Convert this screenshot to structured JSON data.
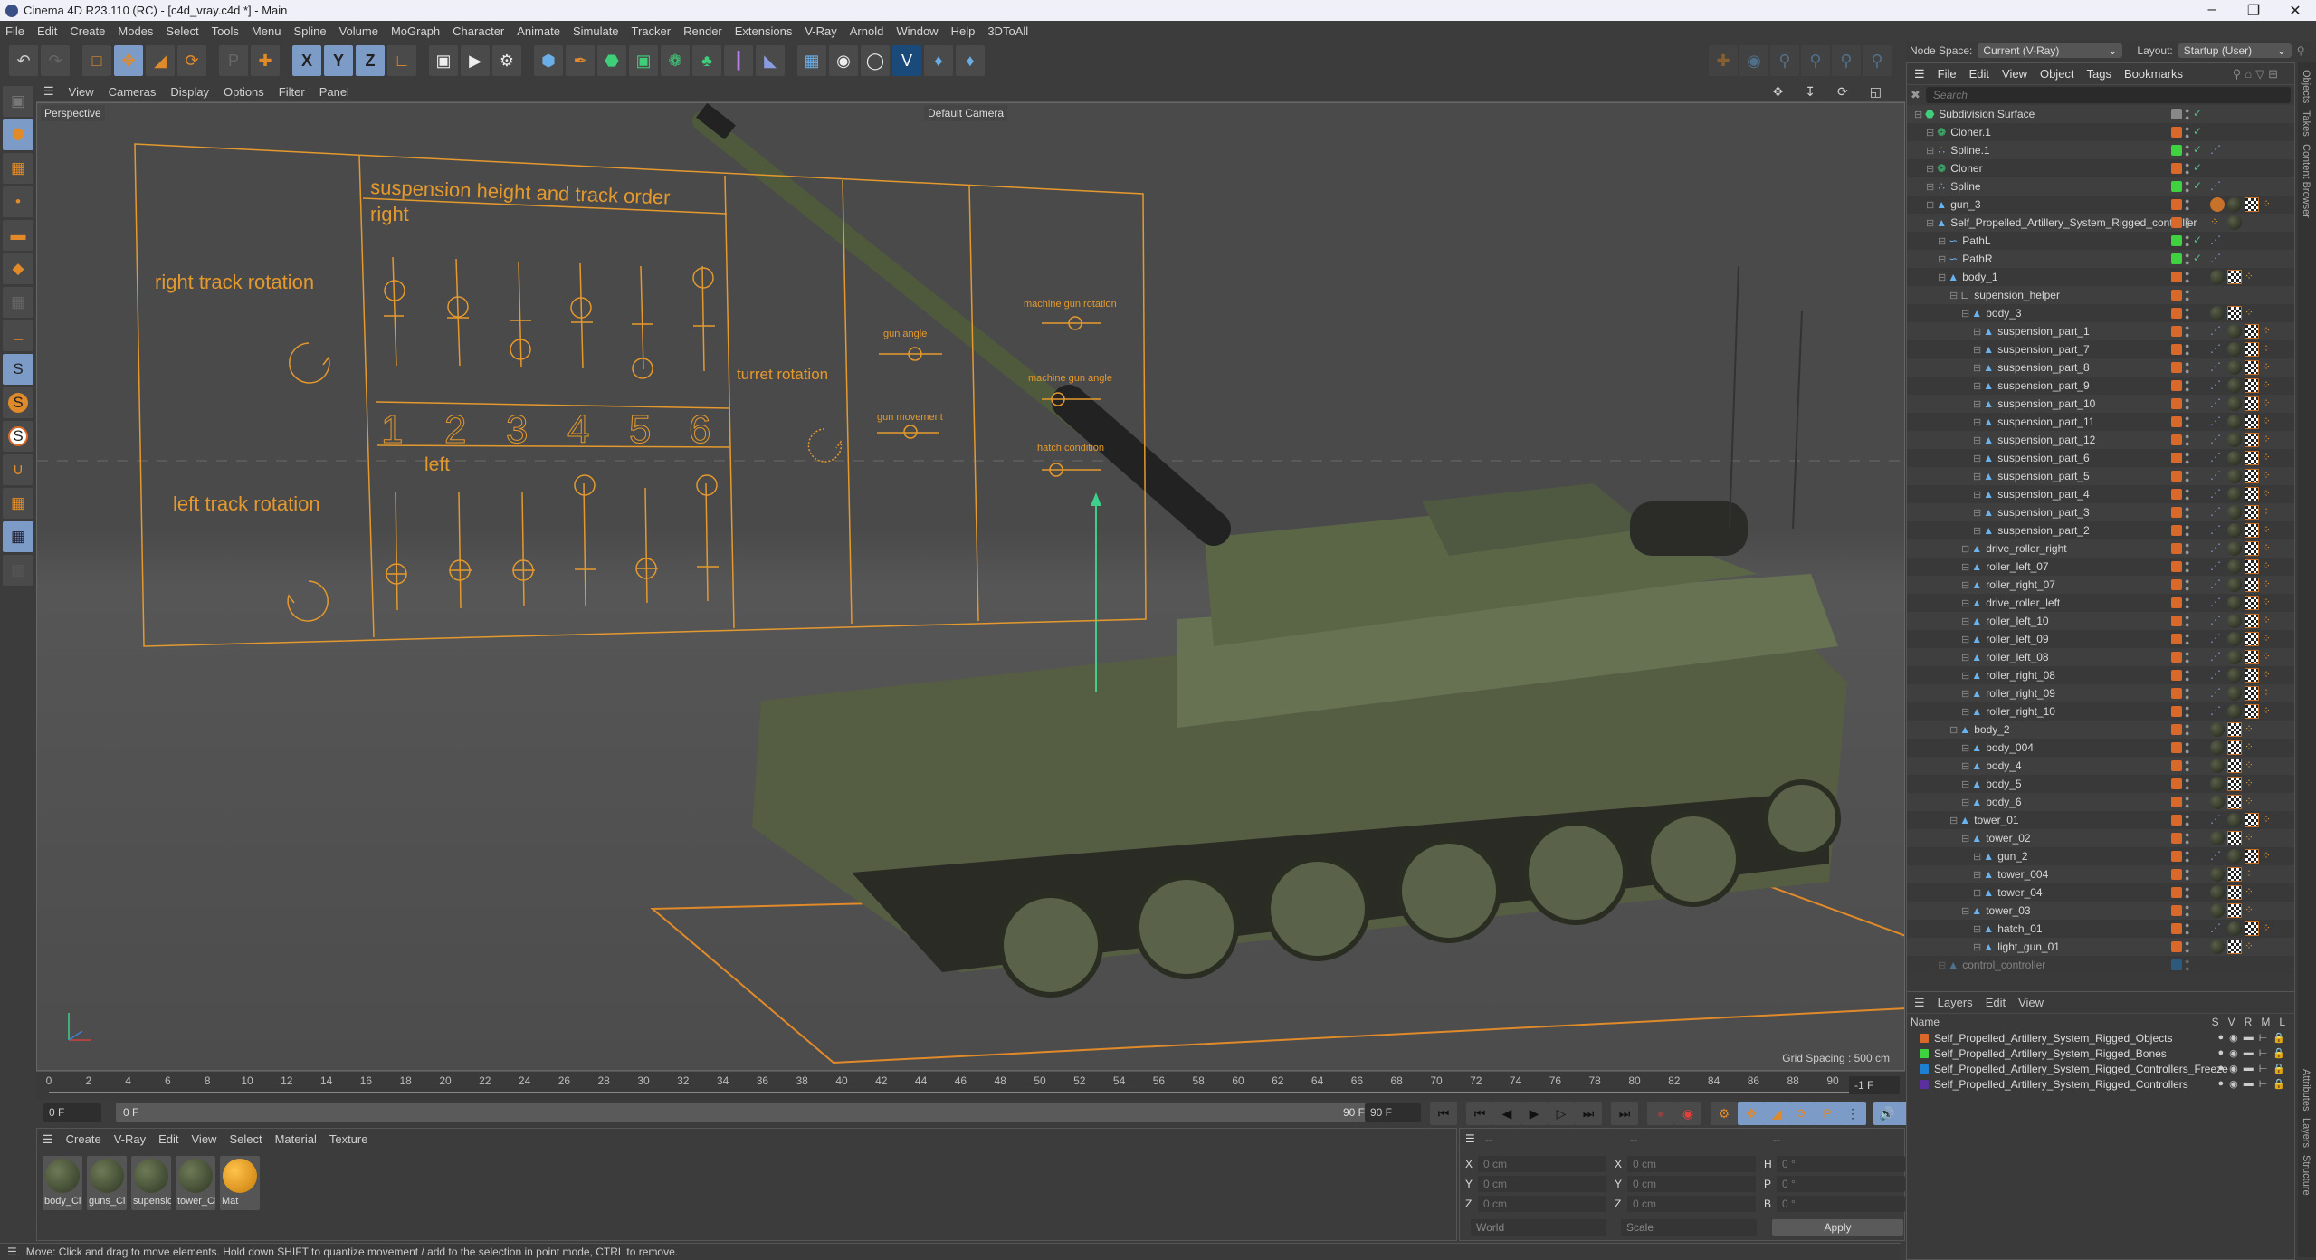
{
  "window": {
    "title": "Cinema 4D R23.110 (RC) - [c4d_vray.c4d *] - Main",
    "controls": [
      "minimize",
      "maximize",
      "close"
    ]
  },
  "menubar": [
    "File",
    "Edit",
    "Create",
    "Modes",
    "Select",
    "Tools",
    "Menu",
    "Spline",
    "Volume",
    "MoGraph",
    "Character",
    "Animate",
    "Simulate",
    "Tracker",
    "Render",
    "Extensions",
    "V-Ray",
    "Arnold",
    "Window",
    "Help",
    "3DToAll"
  ],
  "toolbar": {
    "groups": [
      [
        "undo",
        "redo"
      ],
      [
        "live-selection",
        "move",
        "scale",
        "rotate"
      ],
      [
        "psr-recent",
        "axis-move"
      ],
      [
        "x-axis",
        "y-axis",
        "z-axis",
        "coordinate-system"
      ],
      [
        "render-view",
        "render-to-picture-viewer",
        "render-settings"
      ],
      [
        "cube",
        "pen",
        "subdivision",
        "extrude",
        "cloner",
        "instances",
        "symmetry",
        "deformer"
      ],
      [
        "floor",
        "camera",
        "light",
        "vray",
        "python-1",
        "python-2"
      ]
    ],
    "pose_tools": [
      "paint-weights",
      "pose-morph",
      "pin",
      "pin-psr",
      "pin-r",
      "pin-tag"
    ]
  },
  "left_tools": [
    "make-editable",
    "model-mode",
    "texture-mode",
    "point-mode",
    "edge-mode",
    "polygon-mode",
    "uv-mode",
    "axis-mode",
    "solo-off",
    "solo",
    "solo-hierarchy",
    "snap",
    "workplane",
    "locked-workplane",
    "workplane-align"
  ],
  "viewport": {
    "menu": [
      "View",
      "Cameras",
      "Display",
      "Options",
      "Filter",
      "Panel"
    ],
    "view_label": "Perspective",
    "camera_label": "Default Camera",
    "grid_spacing": "Grid Spacing : 500 cm",
    "controller": {
      "left_title_top": "right track rotation",
      "left_title_bottom": "left track rotation",
      "center_title": "suspension height and track order",
      "right_label": "right",
      "left_label": "left",
      "numbers": [
        "1",
        "2",
        "3",
        "4",
        "5",
        "6"
      ],
      "turret": "turret rotation",
      "gun_angle": "gun angle",
      "gun_movement": "gun movement",
      "mg_rotation": "machine gun rotation",
      "mg_angle": "machine gun angle",
      "hatch": "hatch condition"
    }
  },
  "timeline": {
    "ticks": [
      "0",
      "2",
      "4",
      "6",
      "8",
      "10",
      "12",
      "14",
      "16",
      "18",
      "20",
      "22",
      "24",
      "26",
      "28",
      "30",
      "32",
      "34",
      "36",
      "38",
      "40",
      "42",
      "44",
      "46",
      "48",
      "50",
      "52",
      "54",
      "56",
      "58",
      "60",
      "62",
      "64",
      "66",
      "68",
      "70",
      "72",
      "74",
      "76",
      "78",
      "80",
      "82",
      "84",
      "86",
      "88",
      "90"
    ],
    "current_frame": "-1 F",
    "start_field": "0 F",
    "range_start": "0 F",
    "range_end": "90 F",
    "end_field": "90 F"
  },
  "transport": [
    "go-to-start",
    "prev-key",
    "prev-frame",
    "play",
    "next-frame",
    "next-key",
    "go-to-end",
    "record-keys",
    "autokey",
    "keyframe-selection",
    "key-position",
    "key-scale",
    "key-rotation",
    "key-param",
    "key-pla",
    "sound",
    "timeline-view"
  ],
  "materials": {
    "menu": [
      "Create",
      "V-Ray",
      "Edit",
      "View",
      "Select",
      "Material",
      "Texture"
    ],
    "items": [
      "body_Cl",
      "guns_Cl",
      "supensic",
      "tower_Cl",
      "Mat"
    ]
  },
  "coordinates": {
    "header": [
      "--",
      "--",
      "--"
    ],
    "position": [
      {
        "axis": "X",
        "value": "0 cm"
      },
      {
        "axis": "Y",
        "value": "0 cm"
      },
      {
        "axis": "Z",
        "value": "0 cm"
      }
    ],
    "size": [
      {
        "axis": "X",
        "value": "0 cm"
      },
      {
        "axis": "Y",
        "value": "0 cm"
      },
      {
        "axis": "Z",
        "value": "0 cm"
      }
    ],
    "rotation": [
      {
        "axis": "H",
        "value": "0 °"
      },
      {
        "axis": "P",
        "value": "0 °"
      },
      {
        "axis": "B",
        "value": "0 °"
      }
    ],
    "mode": "World",
    "scale_mode": "Scale",
    "apply": "Apply"
  },
  "status": "Move: Click and drag to move elements. Hold down SHIFT to quantize movement / add to the selection in point mode, CTRL to remove.",
  "right_panel": {
    "node_space_label": "Node Space:",
    "node_space_value": "Current (V-Ray)",
    "layout_label": "Layout:",
    "layout_value": "Startup (User)",
    "object_menu": [
      "File",
      "Edit",
      "View",
      "Object",
      "Tags",
      "Bookmarks"
    ],
    "search_placeholder": "Search",
    "side_tabs": [
      "Objects",
      "Takes",
      "Content Browser",
      "Attributes",
      "Layers",
      "Structure"
    ],
    "objects": [
      {
        "name": "Subdivision Surface",
        "depth": 0,
        "icon": "subdivision",
        "layer": "#888888",
        "check": true,
        "tags": []
      },
      {
        "name": "Cloner.1",
        "depth": 1,
        "icon": "cloner",
        "layer": "#d9692a",
        "check": true,
        "tags": []
      },
      {
        "name": "Spline.1",
        "depth": 1,
        "icon": "spline",
        "layer": "#3fd13f",
        "check": true,
        "tags": [
          "ik"
        ]
      },
      {
        "name": "Cloner",
        "depth": 1,
        "icon": "cloner",
        "layer": "#d9692a",
        "check": true,
        "tags": []
      },
      {
        "name": "Spline",
        "depth": 1,
        "icon": "spline",
        "layer": "#3fd13f",
        "check": true,
        "tags": [
          "ik"
        ]
      },
      {
        "name": "gun_3",
        "depth": 1,
        "icon": "poly",
        "layer": "#d9692a",
        "check": false,
        "tags": [
          "weight",
          "mat",
          "chk",
          "bone"
        ]
      },
      {
        "name": "Self_Propelled_Artillery_System_Rigged_controller",
        "depth": 1,
        "icon": "poly",
        "layer": "#d9692a",
        "check": false,
        "tags": [
          "bone",
          "mat"
        ]
      },
      {
        "name": "PathL",
        "depth": 2,
        "icon": "path",
        "layer": "#3fd13f",
        "check": true,
        "tags": [
          "ik"
        ]
      },
      {
        "name": "PathR",
        "depth": 2,
        "icon": "path",
        "layer": "#3fd13f",
        "check": true,
        "tags": [
          "ik"
        ]
      },
      {
        "name": "body_1",
        "depth": 2,
        "icon": "poly",
        "layer": "#d9692a",
        "check": false,
        "tags": [
          "mat",
          "chk",
          "bone"
        ]
      },
      {
        "name": "supension_helper",
        "depth": 3,
        "icon": "helper",
        "layer": "#d9692a",
        "check": false,
        "tags": []
      },
      {
        "name": "body_3",
        "depth": 4,
        "icon": "poly",
        "layer": "#d9692a",
        "check": false,
        "tags": [
          "mat",
          "chk",
          "bone"
        ]
      },
      {
        "name": "suspension_part_1",
        "depth": 5,
        "icon": "poly",
        "layer": "#d9692a",
        "check": false,
        "tags": [
          "ik",
          "mat",
          "chk",
          "bone"
        ]
      },
      {
        "name": "suspension_part_7",
        "depth": 5,
        "icon": "poly",
        "layer": "#d9692a",
        "check": false,
        "tags": [
          "ik",
          "mat",
          "chk",
          "bone"
        ]
      },
      {
        "name": "suspension_part_8",
        "depth": 5,
        "icon": "poly",
        "layer": "#d9692a",
        "check": false,
        "tags": [
          "ik",
          "mat",
          "chk",
          "bone"
        ]
      },
      {
        "name": "suspension_part_9",
        "depth": 5,
        "icon": "poly",
        "layer": "#d9692a",
        "check": false,
        "tags": [
          "ik",
          "mat",
          "chk",
          "bone"
        ]
      },
      {
        "name": "suspension_part_10",
        "depth": 5,
        "icon": "poly",
        "layer": "#d9692a",
        "check": false,
        "tags": [
          "ik",
          "mat",
          "chk",
          "bone"
        ]
      },
      {
        "name": "suspension_part_11",
        "depth": 5,
        "icon": "poly",
        "layer": "#d9692a",
        "check": false,
        "tags": [
          "ik",
          "mat",
          "chk",
          "bone"
        ]
      },
      {
        "name": "suspension_part_12",
        "depth": 5,
        "icon": "poly",
        "layer": "#d9692a",
        "check": false,
        "tags": [
          "ik",
          "mat",
          "chk",
          "bone"
        ]
      },
      {
        "name": "suspension_part_6",
        "depth": 5,
        "icon": "poly",
        "layer": "#d9692a",
        "check": false,
        "tags": [
          "ik",
          "mat",
          "chk",
          "bone"
        ]
      },
      {
        "name": "suspension_part_5",
        "depth": 5,
        "icon": "poly",
        "layer": "#d9692a",
        "check": false,
        "tags": [
          "ik",
          "mat",
          "chk",
          "bone"
        ]
      },
      {
        "name": "suspension_part_4",
        "depth": 5,
        "icon": "poly",
        "layer": "#d9692a",
        "check": false,
        "tags": [
          "ik",
          "mat",
          "chk",
          "bone"
        ]
      },
      {
        "name": "suspension_part_3",
        "depth": 5,
        "icon": "poly",
        "layer": "#d9692a",
        "check": false,
        "tags": [
          "ik",
          "mat",
          "chk",
          "bone"
        ]
      },
      {
        "name": "suspension_part_2",
        "depth": 5,
        "icon": "poly",
        "layer": "#d9692a",
        "check": false,
        "tags": [
          "ik",
          "mat",
          "chk",
          "bone"
        ]
      },
      {
        "name": "drive_roller_right",
        "depth": 4,
        "icon": "poly",
        "layer": "#d9692a",
        "check": false,
        "tags": [
          "ik",
          "mat",
          "chk",
          "bone"
        ]
      },
      {
        "name": "roller_left_07",
        "depth": 4,
        "icon": "poly",
        "layer": "#d9692a",
        "check": false,
        "tags": [
          "ik",
          "mat",
          "chk",
          "bone"
        ]
      },
      {
        "name": "roller_right_07",
        "depth": 4,
        "icon": "poly",
        "layer": "#d9692a",
        "check": false,
        "tags": [
          "ik",
          "mat",
          "chk",
          "bone"
        ]
      },
      {
        "name": "drive_roller_left",
        "depth": 4,
        "icon": "poly",
        "layer": "#d9692a",
        "check": false,
        "tags": [
          "ik",
          "mat",
          "chk",
          "bone"
        ]
      },
      {
        "name": "roller_left_10",
        "depth": 4,
        "icon": "poly",
        "layer": "#d9692a",
        "check": false,
        "tags": [
          "ik",
          "mat",
          "chk",
          "bone"
        ]
      },
      {
        "name": "roller_left_09",
        "depth": 4,
        "icon": "poly",
        "layer": "#d9692a",
        "check": false,
        "tags": [
          "ik",
          "mat",
          "chk",
          "bone"
        ]
      },
      {
        "name": "roller_left_08",
        "depth": 4,
        "icon": "poly",
        "layer": "#d9692a",
        "check": false,
        "tags": [
          "ik",
          "mat",
          "chk",
          "bone"
        ]
      },
      {
        "name": "roller_right_08",
        "depth": 4,
        "icon": "poly",
        "layer": "#d9692a",
        "check": false,
        "tags": [
          "ik",
          "mat",
          "chk",
          "bone"
        ]
      },
      {
        "name": "roller_right_09",
        "depth": 4,
        "icon": "poly",
        "layer": "#d9692a",
        "check": false,
        "tags": [
          "ik",
          "mat",
          "chk",
          "bone"
        ]
      },
      {
        "name": "roller_right_10",
        "depth": 4,
        "icon": "poly",
        "layer": "#d9692a",
        "check": false,
        "tags": [
          "ik",
          "mat",
          "chk",
          "bone"
        ]
      },
      {
        "name": "body_2",
        "depth": 3,
        "icon": "poly",
        "layer": "#d9692a",
        "check": false,
        "tags": [
          "mat",
          "chk",
          "bone"
        ]
      },
      {
        "name": "body_004",
        "depth": 4,
        "icon": "poly",
        "layer": "#d9692a",
        "check": false,
        "tags": [
          "mat",
          "chk",
          "bone"
        ]
      },
      {
        "name": "body_4",
        "depth": 4,
        "icon": "poly",
        "layer": "#d9692a",
        "check": false,
        "tags": [
          "mat",
          "chk",
          "bone"
        ]
      },
      {
        "name": "body_5",
        "depth": 4,
        "icon": "poly",
        "layer": "#d9692a",
        "check": false,
        "tags": [
          "mat",
          "chk",
          "bone"
        ]
      },
      {
        "name": "body_6",
        "depth": 4,
        "icon": "poly",
        "layer": "#d9692a",
        "check": false,
        "tags": [
          "mat",
          "chk",
          "bone"
        ]
      },
      {
        "name": "tower_01",
        "depth": 3,
        "icon": "poly",
        "layer": "#d9692a",
        "check": false,
        "tags": [
          "ik",
          "mat",
          "chk",
          "bone"
        ]
      },
      {
        "name": "tower_02",
        "depth": 4,
        "icon": "poly",
        "layer": "#d9692a",
        "check": false,
        "tags": [
          "mat",
          "chk",
          "bone"
        ]
      },
      {
        "name": "gun_2",
        "depth": 5,
        "icon": "poly",
        "layer": "#d9692a",
        "check": false,
        "tags": [
          "ik",
          "mat",
          "chk",
          "bone"
        ]
      },
      {
        "name": "tower_004",
        "depth": 5,
        "icon": "poly",
        "layer": "#d9692a",
        "check": false,
        "tags": [
          "mat",
          "chk",
          "bone"
        ]
      },
      {
        "name": "tower_04",
        "depth": 5,
        "icon": "poly",
        "layer": "#d9692a",
        "check": false,
        "tags": [
          "mat",
          "chk",
          "bone"
        ]
      },
      {
        "name": "tower_03",
        "depth": 4,
        "icon": "poly",
        "layer": "#d9692a",
        "check": false,
        "tags": [
          "mat",
          "chk",
          "bone"
        ]
      },
      {
        "name": "hatch_01",
        "depth": 5,
        "icon": "poly",
        "layer": "#d9692a",
        "check": false,
        "tags": [
          "ik",
          "mat",
          "chk",
          "bone"
        ]
      },
      {
        "name": "light_gun_01",
        "depth": 5,
        "icon": "poly",
        "layer": "#d9692a",
        "check": false,
        "tags": [
          "mat",
          "chk",
          "bone"
        ]
      },
      {
        "name": "control_controller",
        "depth": 2,
        "icon": "poly",
        "layer": "#1f7fd0",
        "check": false,
        "tags": [],
        "dimmed": true
      }
    ],
    "layers_menu": [
      "Layers",
      "Edit",
      "View"
    ],
    "layers_columns": [
      "Name",
      "S",
      "V",
      "R",
      "M",
      "L"
    ],
    "layers": [
      {
        "name": "Self_Propelled_Artillery_System_Rigged_Objects",
        "color": "#d9692a"
      },
      {
        "name": "Self_Propelled_Artillery_System_Rigged_Bones",
        "color": "#3fd13f"
      },
      {
        "name": "Self_Propelled_Artillery_System_Rigged_Controllers_Freeze",
        "color": "#1f7fd0"
      },
      {
        "name": "Self_Propelled_Artillery_System_Rigged_Controllers",
        "color": "#5b2f9e"
      }
    ]
  }
}
